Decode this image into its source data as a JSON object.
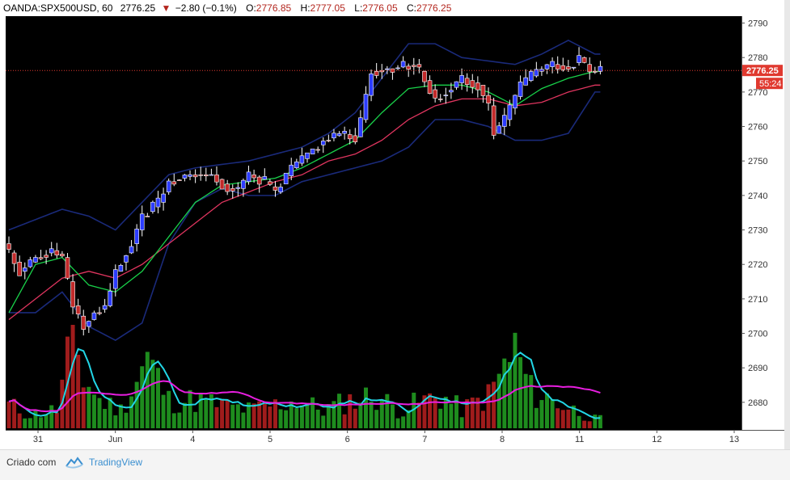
{
  "header": {
    "symbol": "OANDA:SPX500USD, 60",
    "price": "2776.25",
    "down_arrow": "▼",
    "change": "−2.80 (−0.1%)",
    "o_label": "O:",
    "o_value": "2776.85",
    "h_label": "H:",
    "h_value": "2777.05",
    "l_label": "L:",
    "l_value": "2776.05",
    "c_label": "C:",
    "c_value": "2776.25"
  },
  "footer": {
    "credit": "Criado com",
    "brand": "TradingView"
  },
  "colors": {
    "background": "#000000",
    "bull_candle": "#2c3cff",
    "bear_candle": "#c22a2a",
    "ma_fast": "#19d24a",
    "ma_slow": "#e0355f",
    "bollinger": "#1a2a7a",
    "volume_up": "#1e8c1e",
    "volume_down": "#a01c1c",
    "volume_ma_fast": "#22d6e6",
    "volume_ma_slow": "#e81ee0",
    "last_price_tag": "#e0392f"
  },
  "chart_data": {
    "type": "candlestick",
    "symbol": "OANDA:SPX500USD",
    "interval": "60",
    "y_ticks": [
      2680,
      2690,
      2700,
      2710,
      2720,
      2730,
      2740,
      2750,
      2760,
      2770,
      2780,
      2790
    ],
    "ylim": [
      2672,
      2792
    ],
    "x_labels": [
      "31",
      "Jun",
      "4",
      "5",
      "6",
      "7",
      "8",
      "11",
      "12",
      "13"
    ],
    "last_price": "2776.25",
    "countdown": "55:24",
    "grid": false,
    "close_path": [
      [
        0,
        2726
      ],
      [
        3,
        2718
      ],
      [
        6,
        2722
      ],
      [
        9,
        2724
      ],
      [
        11,
        2722
      ],
      [
        13,
        2708
      ],
      [
        15,
        2702
      ],
      [
        17,
        2706
      ],
      [
        19,
        2708
      ],
      [
        21,
        2718
      ],
      [
        24,
        2726
      ],
      [
        26,
        2734
      ],
      [
        29,
        2738
      ],
      [
        31,
        2744
      ],
      [
        35,
        2746
      ],
      [
        39,
        2746
      ],
      [
        42,
        2742
      ],
      [
        44,
        2742
      ],
      [
        46,
        2746
      ],
      [
        49,
        2744
      ],
      [
        51,
        2741
      ],
      [
        54,
        2748
      ],
      [
        57,
        2752
      ],
      [
        60,
        2756
      ],
      [
        63,
        2758
      ],
      [
        66,
        2757
      ],
      [
        67,
        2762
      ],
      [
        69,
        2776
      ],
      [
        73,
        2777
      ],
      [
        77,
        2778
      ],
      [
        78,
        2776
      ],
      [
        81,
        2768
      ],
      [
        83,
        2770
      ],
      [
        86,
        2774
      ],
      [
        89,
        2772
      ],
      [
        91,
        2766
      ],
      [
        92,
        2758
      ],
      [
        94,
        2762
      ],
      [
        97,
        2772
      ],
      [
        100,
        2776
      ],
      [
        103,
        2778
      ],
      [
        106,
        2777
      ],
      [
        108,
        2780
      ],
      [
        110,
        2776
      ]
    ],
    "bollinger_upper_path": [
      [
        0,
        2730
      ],
      [
        10,
        2736
      ],
      [
        15,
        2734
      ],
      [
        20,
        2730
      ],
      [
        25,
        2738
      ],
      [
        30,
        2746
      ],
      [
        35,
        2748
      ],
      [
        40,
        2749
      ],
      [
        45,
        2750
      ],
      [
        50,
        2752
      ],
      [
        55,
        2754
      ],
      [
        60,
        2758
      ],
      [
        65,
        2764
      ],
      [
        70,
        2774
      ],
      [
        75,
        2784
      ],
      [
        80,
        2784
      ],
      [
        85,
        2780
      ],
      [
        90,
        2779
      ],
      [
        95,
        2778
      ],
      [
        100,
        2781
      ],
      [
        105,
        2785
      ],
      [
        110,
        2781
      ]
    ],
    "bollinger_lower_path": [
      [
        0,
        2706
      ],
      [
        5,
        2706
      ],
      [
        10,
        2712
      ],
      [
        15,
        2702
      ],
      [
        20,
        2698
      ],
      [
        25,
        2703
      ],
      [
        30,
        2726
      ],
      [
        35,
        2738
      ],
      [
        40,
        2742
      ],
      [
        45,
        2740
      ],
      [
        50,
        2740
      ],
      [
        55,
        2744
      ],
      [
        60,
        2746
      ],
      [
        65,
        2748
      ],
      [
        70,
        2750
      ],
      [
        75,
        2754
      ],
      [
        80,
        2762
      ],
      [
        85,
        2762
      ],
      [
        90,
        2760
      ],
      [
        95,
        2756
      ],
      [
        100,
        2756
      ],
      [
        105,
        2758
      ],
      [
        110,
        2770
      ]
    ],
    "ma_fast_path": [
      [
        0,
        2706
      ],
      [
        5,
        2720
      ],
      [
        10,
        2722
      ],
      [
        15,
        2714
      ],
      [
        20,
        2712
      ],
      [
        25,
        2718
      ],
      [
        30,
        2728
      ],
      [
        35,
        2738
      ],
      [
        40,
        2743
      ],
      [
        45,
        2744
      ],
      [
        50,
        2745
      ],
      [
        55,
        2748
      ],
      [
        60,
        2752
      ],
      [
        65,
        2756
      ],
      [
        70,
        2764
      ],
      [
        75,
        2771
      ],
      [
        80,
        2772
      ],
      [
        85,
        2772
      ],
      [
        90,
        2770
      ],
      [
        95,
        2766
      ],
      [
        100,
        2771
      ],
      [
        105,
        2774
      ],
      [
        110,
        2776
      ]
    ],
    "ma_slow_path": [
      [
        0,
        2704
      ],
      [
        5,
        2710
      ],
      [
        10,
        2716
      ],
      [
        15,
        2718
      ],
      [
        20,
        2716
      ],
      [
        25,
        2720
      ],
      [
        30,
        2726
      ],
      [
        35,
        2732
      ],
      [
        40,
        2738
      ],
      [
        45,
        2741
      ],
      [
        50,
        2744
      ],
      [
        55,
        2746
      ],
      [
        60,
        2750
      ],
      [
        65,
        2752
      ],
      [
        70,
        2756
      ],
      [
        75,
        2762
      ],
      [
        80,
        2766
      ],
      [
        85,
        2768
      ],
      [
        90,
        2768
      ],
      [
        95,
        2766
      ],
      [
        100,
        2767
      ],
      [
        105,
        2770
      ],
      [
        110,
        2772
      ]
    ],
    "volume_profile": [
      [
        0,
        0.25
      ],
      [
        4,
        0.15
      ],
      [
        9,
        0.2
      ],
      [
        12,
        1.0
      ],
      [
        14,
        0.55
      ],
      [
        17,
        0.3
      ],
      [
        21,
        0.2
      ],
      [
        26,
        0.75
      ],
      [
        30,
        0.3
      ],
      [
        35,
        0.3
      ],
      [
        40,
        0.25
      ],
      [
        45,
        0.2
      ],
      [
        50,
        0.25
      ],
      [
        54,
        0.3
      ],
      [
        59,
        0.2
      ],
      [
        64,
        0.3
      ],
      [
        69,
        0.35
      ],
      [
        73,
        0.2
      ],
      [
        78,
        0.3
      ],
      [
        81,
        0.35
      ],
      [
        85,
        0.2
      ],
      [
        90,
        0.35
      ],
      [
        95,
        0.85
      ],
      [
        98,
        0.4
      ],
      [
        102,
        0.3
      ],
      [
        106,
        0.2
      ],
      [
        110,
        0.1
      ]
    ]
  }
}
